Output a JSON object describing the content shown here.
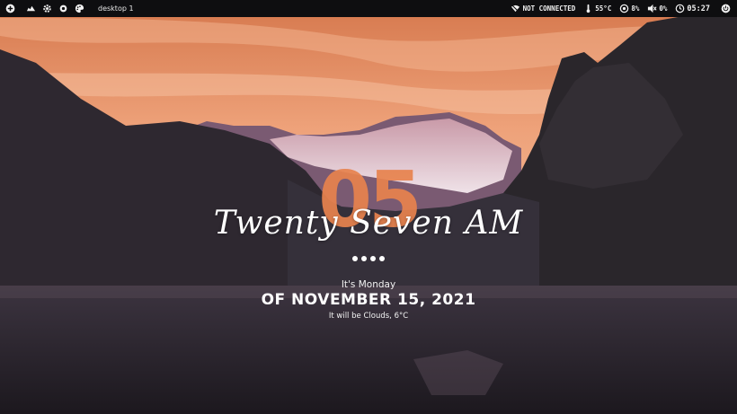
{
  "topbar": {
    "left_icons": [
      "add-circle-icon",
      "cloud-icon",
      "gear-icon",
      "settings-cog-icon",
      "palette-icon"
    ],
    "workspace_label": "desktop 1",
    "network_status": "NOT CONNECTED",
    "temperature": "55°C",
    "cpu_usage": "8%",
    "volume": "0%",
    "time": "05:27"
  },
  "clock": {
    "hour": "05",
    "minute_words": "Twenty Seven AM",
    "page_dots": 4,
    "day_text": "It's Monday",
    "date_text": "OF NOVEMBER 15, 2021",
    "weather_text": "It will be Clouds, 6°C"
  },
  "colors": {
    "accent": "#e8834e",
    "topbar_bg": "#0e0e10",
    "sky_top": "#d97a4a",
    "sky_bottom": "#f4b690"
  }
}
